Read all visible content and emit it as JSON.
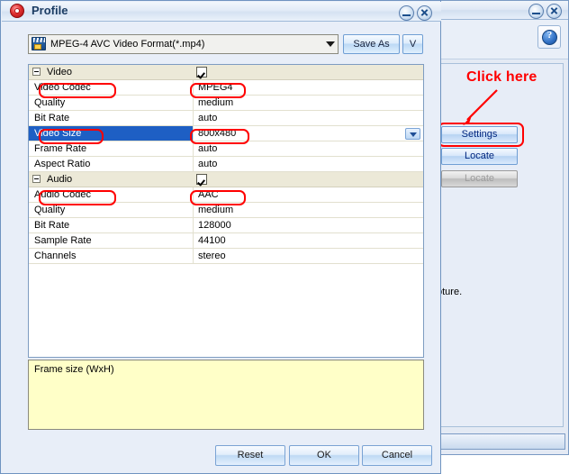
{
  "background_window": {
    "help_button_glyph": "?",
    "truncated_text": "pture.",
    "annotation": {
      "callout": "Click here"
    },
    "buttons": [
      {
        "label": "Settings",
        "state": "enabled",
        "highlighted": true
      },
      {
        "label": "Locate",
        "state": "enabled",
        "highlighted": false
      },
      {
        "label": "Locate",
        "state": "disabled",
        "highlighted": false
      }
    ]
  },
  "dialog": {
    "title": "Profile",
    "icon": "target-gear-icon",
    "titlebar_buttons": {
      "minimize": "minimize-icon",
      "close": "close-icon"
    },
    "format_combo": {
      "value": "MPEG-4 AVC Video Format(*.mp4)",
      "icon": "video-file-icon"
    },
    "save_as_label": "Save As",
    "v_button_label": "V",
    "grid": {
      "rows": [
        {
          "type": "group",
          "name": "Video",
          "value": "",
          "checked": true
        },
        {
          "type": "item",
          "name": "Video Codec",
          "value": "MPEG4",
          "boxed": true
        },
        {
          "type": "item",
          "name": "Quality",
          "value": "medium"
        },
        {
          "type": "item",
          "name": "Bit Rate",
          "value": "auto"
        },
        {
          "type": "item",
          "name": "Video Size",
          "value": "800x480",
          "boxed": true,
          "selected": true,
          "dropdown": true
        },
        {
          "type": "item",
          "name": "Frame Rate",
          "value": "auto"
        },
        {
          "type": "item",
          "name": "Aspect Ratio",
          "value": "auto"
        },
        {
          "type": "group",
          "name": "Audio",
          "value": "",
          "checked": true
        },
        {
          "type": "item",
          "name": "Audio Codec",
          "value": "AAC",
          "boxed": true
        },
        {
          "type": "item",
          "name": "Quality",
          "value": "medium"
        },
        {
          "type": "item",
          "name": "Bit Rate",
          "value": "128000"
        },
        {
          "type": "item",
          "name": "Sample Rate",
          "value": "44100"
        },
        {
          "type": "item",
          "name": "Channels",
          "value": "stereo"
        }
      ]
    },
    "description": "Frame size (WxH)",
    "footer_buttons": {
      "reset": "Reset",
      "ok": "OK",
      "cancel": "Cancel"
    }
  },
  "colors": {
    "annotation_red": "#ff0000",
    "selection_blue": "#1e5fc4",
    "group_row": "#ece9d8",
    "description_bg": "#ffffc8"
  }
}
